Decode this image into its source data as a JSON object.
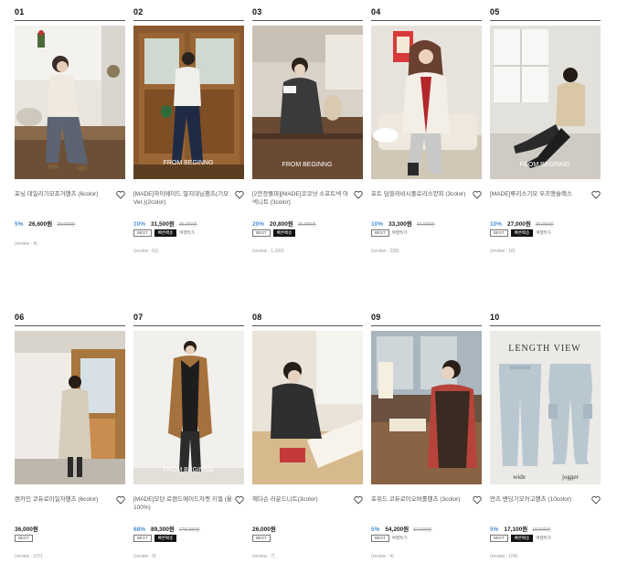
{
  "products": [
    {
      "rank": "01",
      "name": "포닝 데일리기모조거팬츠 (6color)",
      "discount": "5%",
      "price": "26,600원",
      "original": "28,000원",
      "badges": [],
      "extra": "여행특가",
      "review": "(review : 4)"
    },
    {
      "rank": "02",
      "name": "[MADE]하이메이드 밀지데님팬츠(기모Ver.)(2color)",
      "discount": "10%",
      "price": "31,500원",
      "original": "35,000원",
      "badges": [
        "BEST",
        "빠른배송"
      ],
      "extra": "여행특가",
      "review": "(review : 51)"
    },
    {
      "rank": "03",
      "name": "[2만장돌파][MADE]코코넛 소프트넥 아넥니트 (3color)",
      "discount": "20%",
      "price": "20,800원",
      "original": "26,000원",
      "badges": [
        "BEST",
        "빠른배송"
      ],
      "extra": "",
      "review": "(review : 1,100)"
    },
    {
      "rank": "04",
      "name": "포트 덤블러비시폴로리스양피 (3color)",
      "discount": "10%",
      "price": "33,300원",
      "original": "37,000원",
      "badges": [
        "BEST"
      ],
      "extra": "여행특가",
      "review": "(review : 339)"
    },
    {
      "rank": "05",
      "name": "[MADE]루리스기모 우즈앵슬랙스",
      "discount": "10%",
      "price": "27,000원",
      "original": "30,000원",
      "badges": [
        "BEST",
        "빠른배송"
      ],
      "extra": "여행특가",
      "review": "(review : 18)"
    },
    {
      "rank": "06",
      "name": "렌카인 코듀로이일자팬츠 (6color)",
      "discount": "",
      "price": "36,000원",
      "original": "",
      "badges": [
        "BEST"
      ],
      "extra": "",
      "review": "(review : 107)"
    },
    {
      "rank": "07",
      "name": "[MADE]모던 로렌드메이드자켓 키엘 (울100%)",
      "discount": "68%",
      "price": "89,300원",
      "original": "278,000원",
      "badges": [
        "BEST",
        "빠른배송"
      ],
      "extra": "",
      "review": "(review : 9)"
    },
    {
      "rank": "08",
      "name": "헤더슨 라운드니트(3color)",
      "discount": "",
      "price": "26,000원",
      "original": "",
      "badges": [
        "BEST"
      ],
      "extra": "",
      "review": "(review : 7)"
    },
    {
      "rank": "09",
      "name": "포위드 코듀로이오버롤팬츠 (3color)",
      "discount": "5%",
      "price": "54,200원",
      "original": "57,000원",
      "badges": [
        "BEST"
      ],
      "extra": "여행특가",
      "review": "(review : 4)"
    },
    {
      "rank": "10",
      "name": "먼츠 밴딩기모카고팬츠 (10color)",
      "discount": "5%",
      "price": "17,100원",
      "original": "18,000원",
      "badges": [
        "BEST",
        "빠른배송"
      ],
      "extra": "여행특가",
      "review": "(review : 104)"
    }
  ],
  "image_captions": {
    "p2": "FROM BEGINNG",
    "p3": "FROM BEGINNG",
    "p5": "FROM BEGINNG",
    "p7": "FROM BEGINNG",
    "p10_title": "LENGTH VIEW",
    "p10_left": "wide",
    "p10_right": "jogger"
  }
}
